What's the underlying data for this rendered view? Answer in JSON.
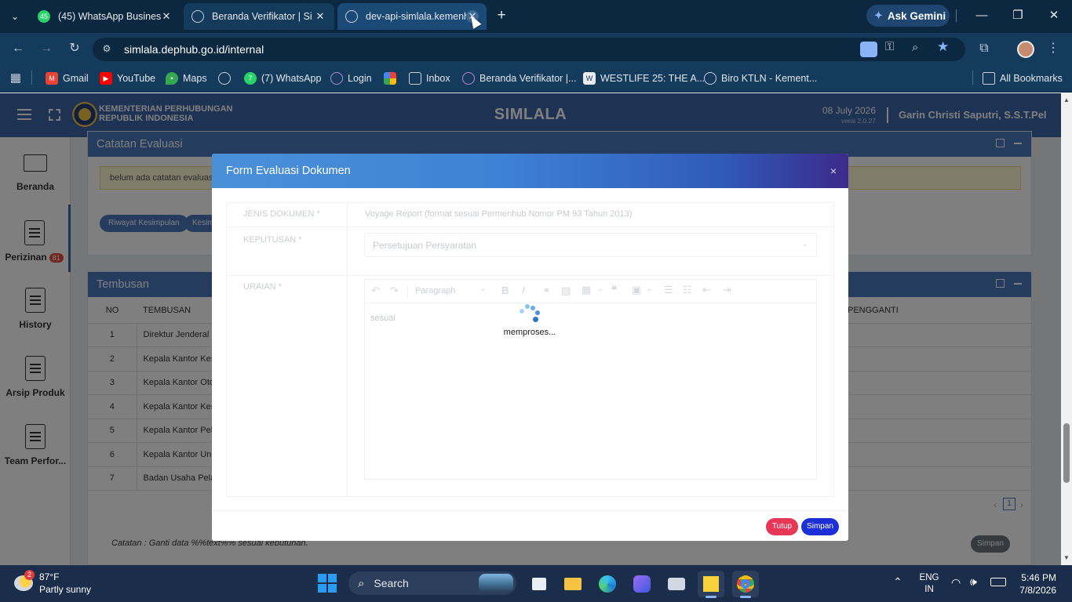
{
  "browser": {
    "tabs": [
      {
        "title": "(45) WhatsApp Busines",
        "badge": "45"
      },
      {
        "title": "Beranda Verifikator | Si",
        "active": true
      },
      {
        "title": "dev-api-simlala.kemenh"
      }
    ],
    "new_tab": "+",
    "ask_gemini": "Ask Gemini",
    "url": "simlala.dephub.go.id/internal",
    "bookmarks": [
      {
        "label": "Gmail"
      },
      {
        "label": "YouTube"
      },
      {
        "label": "Maps"
      },
      {
        "label": ""
      },
      {
        "label": "(7) WhatsApp"
      },
      {
        "label": "Login"
      },
      {
        "label": ""
      },
      {
        "label": "Inbox"
      },
      {
        "label": "Beranda Verifikator |..."
      },
      {
        "label": "WESTLIFE 25: THE A..."
      },
      {
        "label": "Biro KTLN - Kement..."
      }
    ],
    "all_bookmarks": "All Bookmarks"
  },
  "app": {
    "org_line1": "KEMENTERIAN PERHUBUNGAN",
    "org_line2": "REPUBLIK INDONESIA",
    "app_name": "SIMLALA",
    "date": "08 July 2026",
    "version": "versi 2.0.27",
    "user": "Garin Christi Saputri, S.S.T.Pel"
  },
  "sidebar": [
    {
      "label": "Beranda"
    },
    {
      "label": "Perizinan",
      "badge": "81"
    },
    {
      "label": "History"
    },
    {
      "label": "Arsip Produk"
    },
    {
      "label": "Team Perfor..."
    }
  ],
  "catatan": {
    "title": "Catatan Evaluasi",
    "empty_text": "belum ada catatan evaluasi",
    "btn_riwayat": "Riwayat Kesimpulan",
    "btn_kesim": "Kesim"
  },
  "tembusan": {
    "title": "Tembusan",
    "col_no": "NO",
    "col_tembusan": "TEMBUSAN",
    "col_pengganti": "PENGGANTI",
    "rows": [
      {
        "no": "1",
        "name": "Direktur Jenderal Pe"
      },
      {
        "no": "2",
        "name": "Kepala Kantor Kesya"
      },
      {
        "no": "3",
        "name": "Kepala Kantor Otori"
      },
      {
        "no": "4",
        "name": "Kepala Kantor Kesya"
      },
      {
        "no": "5",
        "name": "Kepala Kantor Pelab"
      },
      {
        "no": "6",
        "name": "Kepala Kantor Unit"
      },
      {
        "no": "7",
        "name": "Badan Usaha Pelabu"
      }
    ],
    "page": "1",
    "note": "Catatan : Ganti data %%text%% sesuai kebutuhan.",
    "simpan": "Simpan"
  },
  "modal": {
    "title": "Form Evaluasi Dokumen",
    "close": "×",
    "jenis_label": "JENIS DOKUMEN *",
    "jenis_value": "Voyage Report (format sesuai Permenhub Nomor PM 93 Tahun 2013)",
    "keputusan_label": "KEPUTUSAN *",
    "keputusan_value": "Persetujuan Persyaratan",
    "uraian_label": "URAIAN *",
    "editor_format": "Paragraph",
    "editor_text": "sesuai",
    "loading_text": "memproses...",
    "btn_tutup": "Tutup",
    "btn_simpan": "Simpan"
  },
  "taskbar": {
    "weather_temp": "87°F",
    "weather_desc": "Partly sunny",
    "weather_badge": "2",
    "search": "Search",
    "lang1": "ENG",
    "lang2": "IN",
    "time": "5:46 PM",
    "date": "7/8/2026"
  }
}
